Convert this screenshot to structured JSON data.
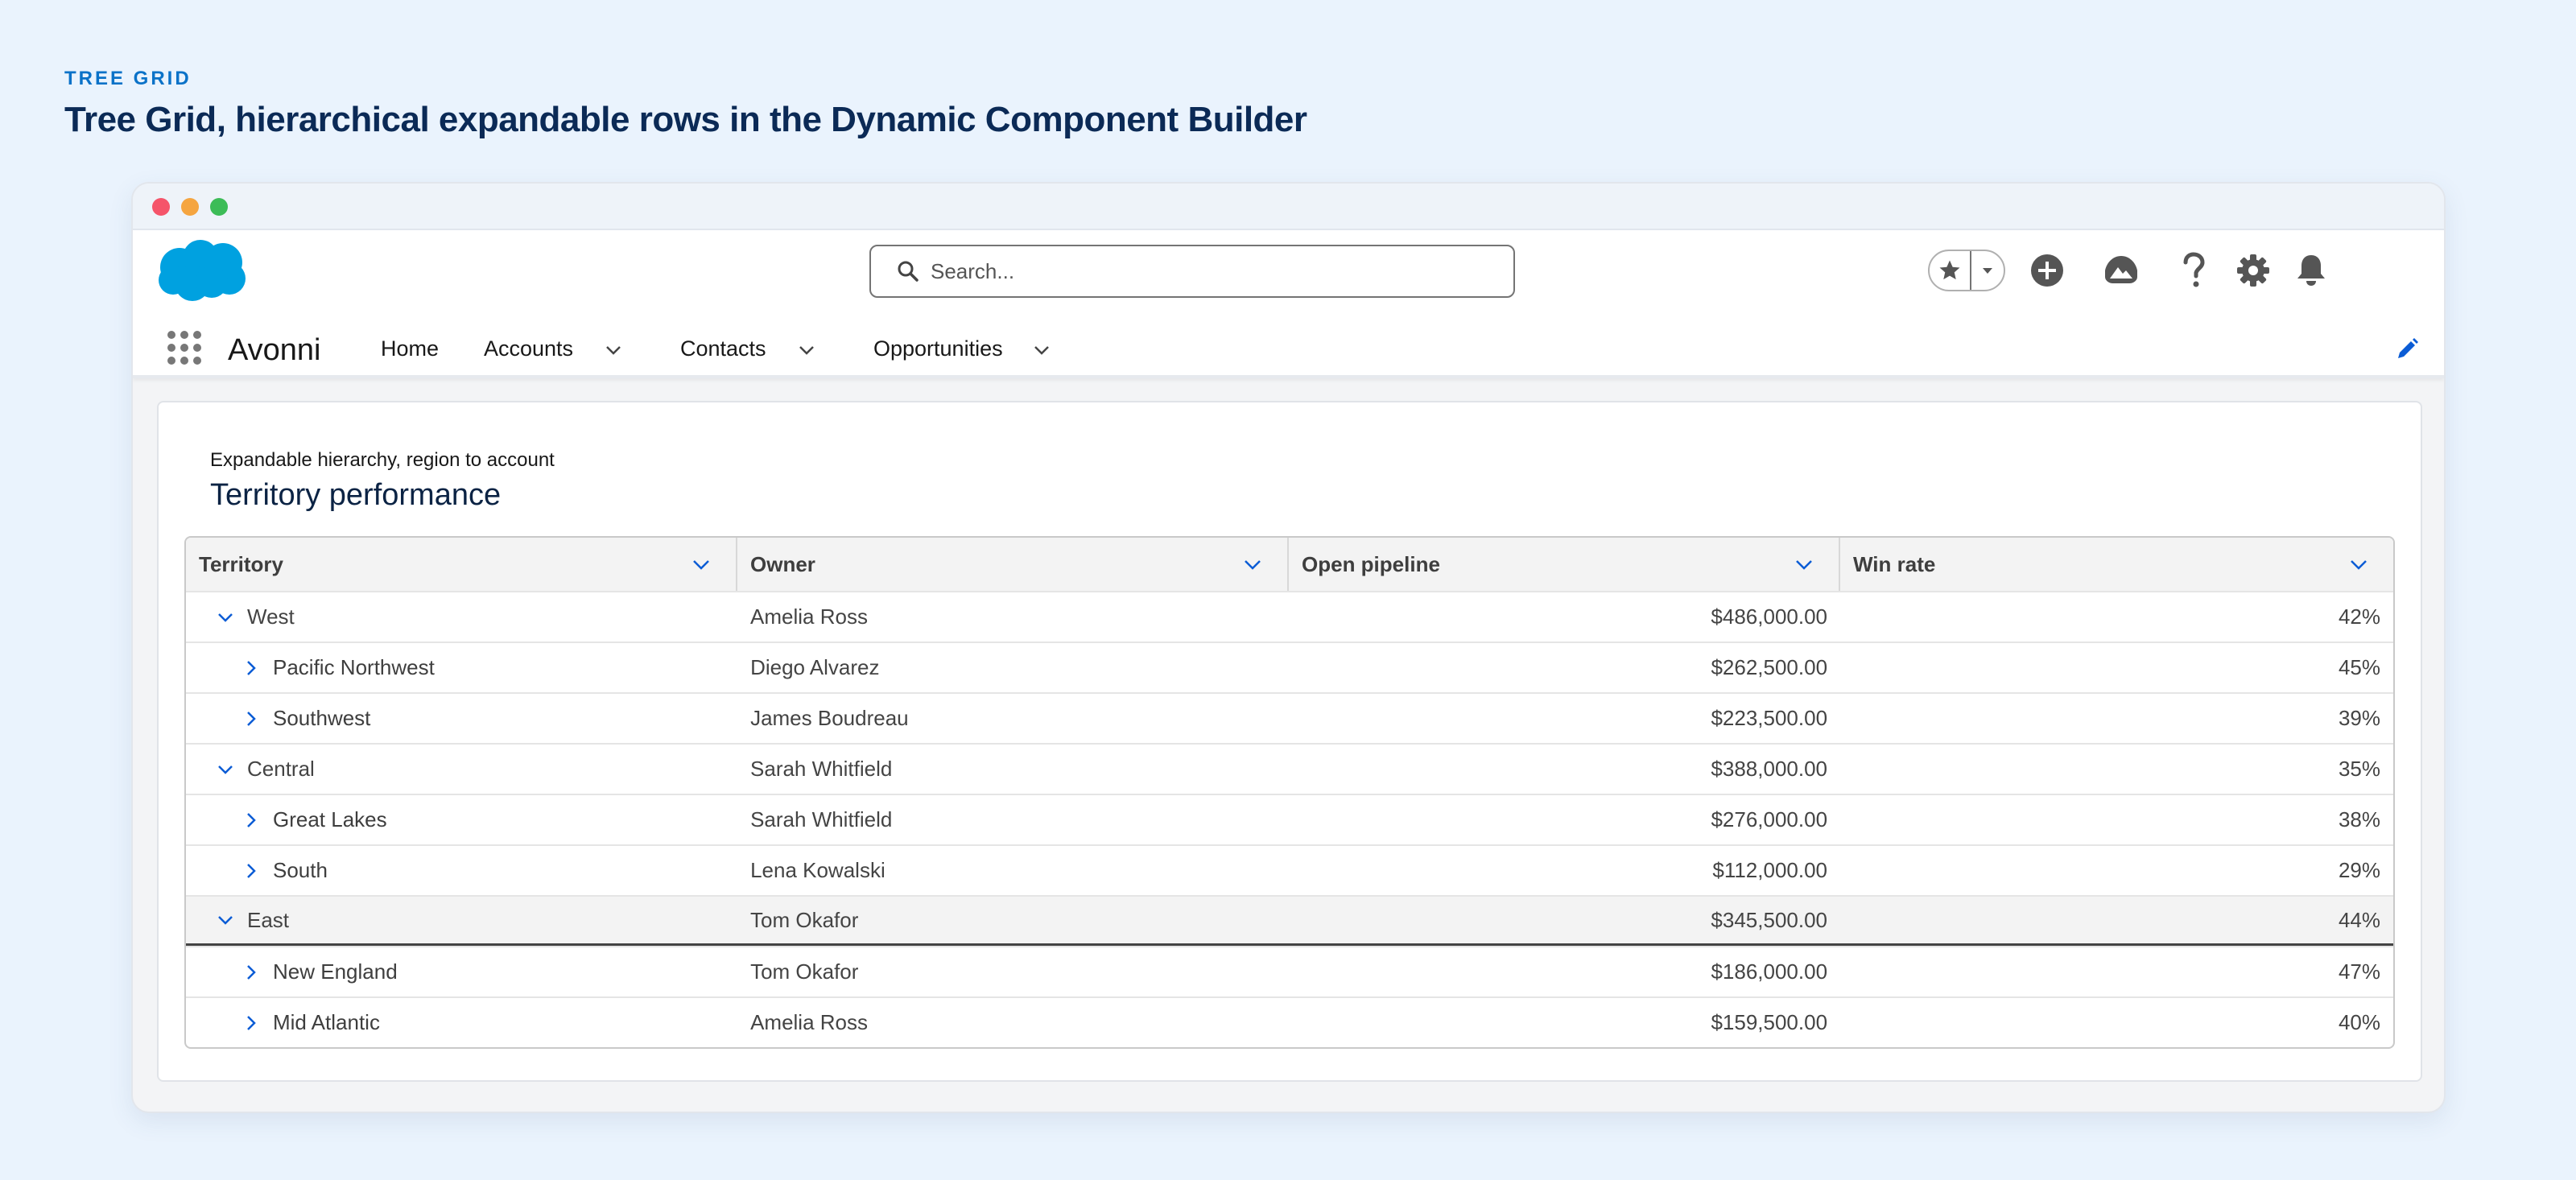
{
  "page": {
    "eyebrow": "TREE GRID",
    "headline": "Tree Grid, hierarchical expandable rows in the Dynamic Component Builder"
  },
  "header": {
    "search_placeholder": "Search..."
  },
  "nav": {
    "app_name": "Avonni",
    "items": [
      {
        "label": "Home"
      },
      {
        "label": "Accounts"
      },
      {
        "label": "Contacts"
      },
      {
        "label": "Opportunities"
      }
    ]
  },
  "card": {
    "subtitle": "Expandable hierarchy, region to account",
    "title": "Territory performance"
  },
  "grid": {
    "columns": [
      "Territory",
      "Owner",
      "Open pipeline",
      "Win rate"
    ],
    "rows": [
      {
        "territory": "West",
        "owner": "Amelia Ross",
        "pipeline": "$486,000.00",
        "win_rate": "42%"
      },
      {
        "territory": "Pacific Northwest",
        "owner": "Diego Alvarez",
        "pipeline": "$262,500.00",
        "win_rate": "45%"
      },
      {
        "territory": "Southwest",
        "owner": "James Boudreau",
        "pipeline": "$223,500.00",
        "win_rate": "39%"
      },
      {
        "territory": "Central",
        "owner": "Sarah Whitfield",
        "pipeline": "$388,000.00",
        "win_rate": "35%"
      },
      {
        "territory": "Great Lakes",
        "owner": "Sarah Whitfield",
        "pipeline": "$276,000.00",
        "win_rate": "38%"
      },
      {
        "territory": "South",
        "owner": "Lena Kowalski",
        "pipeline": "$112,000.00",
        "win_rate": "29%"
      },
      {
        "territory": "East",
        "owner": "Tom Okafor",
        "pipeline": "$345,500.00",
        "win_rate": "44%"
      },
      {
        "territory": "New England",
        "owner": "Tom Okafor",
        "pipeline": "$186,000.00",
        "win_rate": "47%"
      },
      {
        "territory": "Mid Atlantic",
        "owner": "Amelia Ross",
        "pipeline": "$159,500.00",
        "win_rate": "40%"
      }
    ]
  },
  "colors": {
    "accent": "#0b72c8",
    "headline": "#0b2a56",
    "logo": "#00a1e0",
    "link_blue": "#0b5cd5",
    "background": "#eaf3fd"
  },
  "icons": {
    "logo": "salesforce-cloud-icon",
    "search": "search-icon",
    "favorites": "star-icon",
    "add": "plus-circle-icon",
    "guidance": "trailhead-icon",
    "help": "question-icon",
    "settings": "gear-icon",
    "notifications": "bell-icon",
    "app_launcher": "waffle-icon",
    "edit": "pencil-icon"
  }
}
